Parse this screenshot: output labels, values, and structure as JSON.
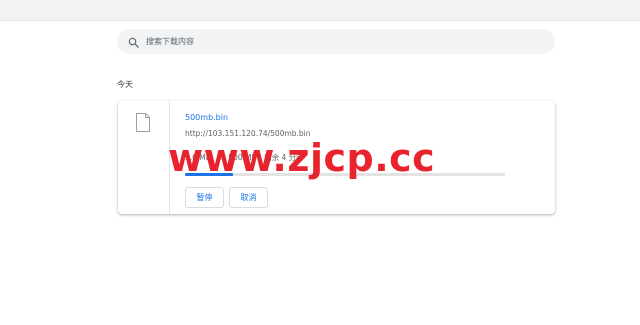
{
  "search": {
    "placeholder": "搜索下载内容"
  },
  "section": {
    "date_label": "今天"
  },
  "download": {
    "file_name": "500mb.bin",
    "url": "http://103.151.120.74/500mb.bin",
    "status": "3.0 MB，共 500 MB，剩余 4 分钟",
    "progress_fraction": 0.15,
    "pause_label": "暂停",
    "cancel_label": "取消"
  },
  "watermark": {
    "text": "www.zjcp.cc"
  },
  "colors": {
    "accent": "#1a73e8",
    "watermark": "#e8232d",
    "search_bg": "#f1f3f4"
  },
  "icons": {
    "search": "search-icon",
    "file": "file-icon"
  }
}
